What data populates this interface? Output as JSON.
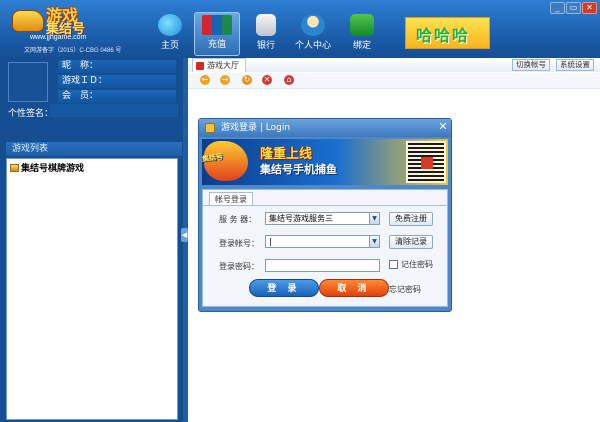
{
  "logo": {
    "line1": "游戏",
    "line2": "集结号",
    "url": "www.jjhgame.com",
    "license": "文网游备字（2015）C-CBG 0486 号"
  },
  "nav": {
    "home": "主页",
    "recharge": "充值",
    "bank": "银行",
    "user_center": "个人中心",
    "bind": "绑定"
  },
  "banner_text": "哈哈哈",
  "window_controls": {
    "min": "_",
    "max": "▭",
    "close": "✕"
  },
  "profile": {
    "nickname_label": "昵　称：",
    "game_id_label": "游戏ＩＤ：",
    "member_label": "会　员：",
    "signature_label": "个性签名："
  },
  "game_list": {
    "title": "游戏列表",
    "items": [
      "集结号棋牌游戏"
    ]
  },
  "tabs": {
    "hall": "游戏大厅"
  },
  "top_buttons": {
    "switch_account": "切换帐号",
    "settings": "系统设置"
  },
  "toolbar": {
    "back": "←",
    "forward": "→",
    "refresh": "↻",
    "stop": "✕",
    "home": "⌂"
  },
  "login_dialog": {
    "title": "游戏登录 | Login",
    "close": "✕",
    "ad": {
      "brand": "集结号",
      "headline": "隆重上线",
      "subline": "集结号手机捕鱼"
    },
    "tab": "帐号登录",
    "server_label": "服 务 器：",
    "server_value": "集结号游戏服务三",
    "account_label": "登录帐号：",
    "account_value": "|",
    "password_label": "登录密码：",
    "password_value": "",
    "register_button": "免费注册",
    "clear_button": "清除记录",
    "remember_password": "记住密码",
    "login_button": "登 录",
    "cancel_button": "取 消",
    "forgot_password": "忘记密码"
  },
  "colors": {
    "frame_blue": "#1e5fa3",
    "login_blue": "#1761b7",
    "cancel_orange": "#e2420f"
  }
}
